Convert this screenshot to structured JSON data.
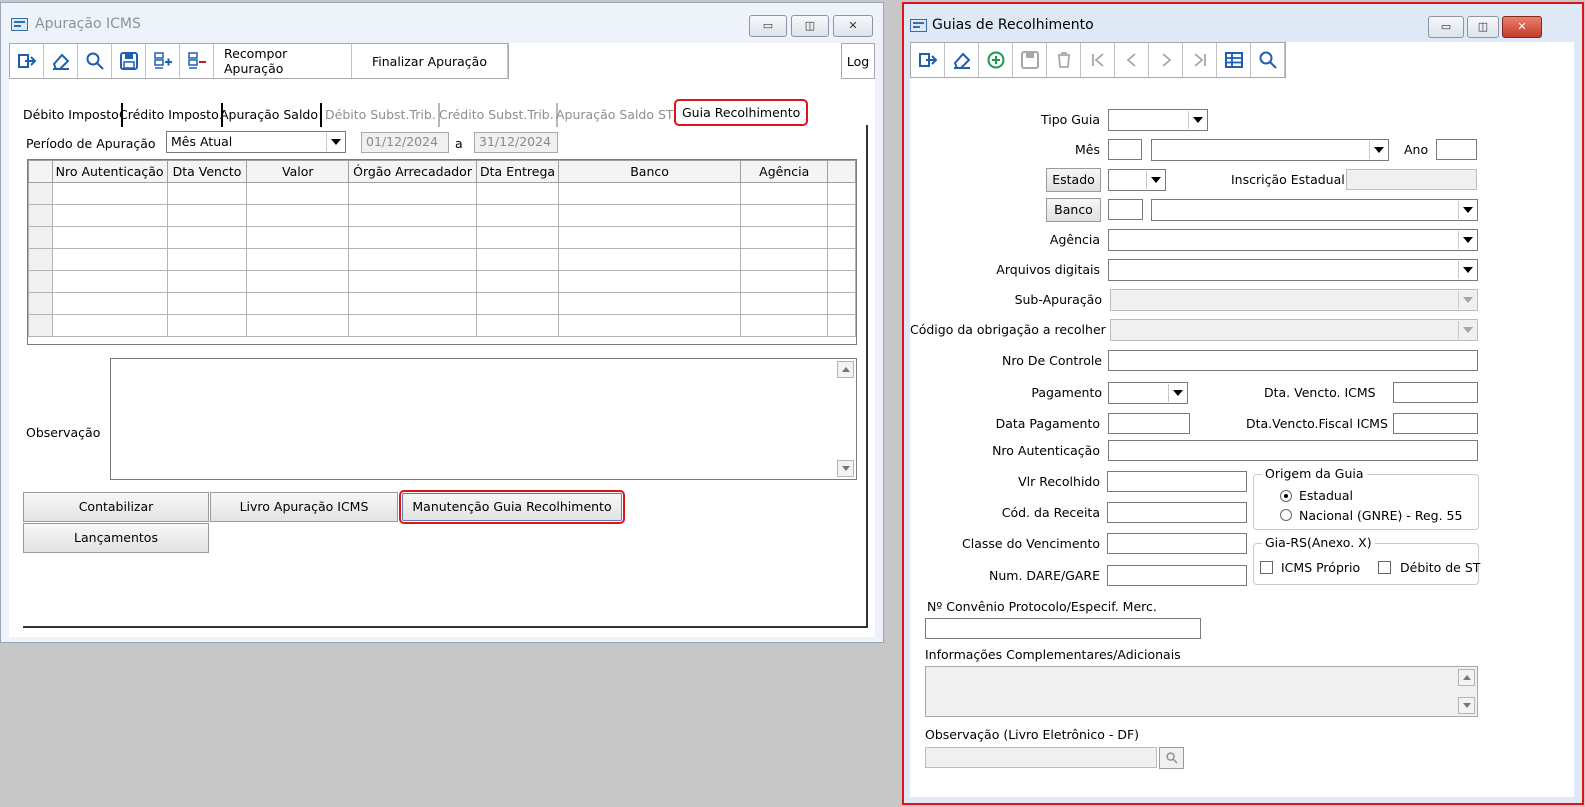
{
  "left_window": {
    "title": "Apuração ICMS",
    "caption_buttons": [
      "▭",
      "◫",
      "✕"
    ],
    "toolbar": {
      "recompor_label": "Recompor Apuração",
      "finalizar_label": "Finalizar Apuração",
      "log_label": "Log"
    },
    "tabs": [
      {
        "label": "Débito Imposto"
      },
      {
        "label": "Crédito Imposto"
      },
      {
        "label": "Apuração Saldo"
      },
      {
        "label": "Débito Subst.Trib."
      },
      {
        "label": "Crédito Subst.Trib."
      },
      {
        "label": "Apuração Saldo ST"
      },
      {
        "label": "Guia Recolhimento"
      }
    ],
    "periodo": {
      "label": "Período de Apuração",
      "selected": "Mês Atual",
      "start": "01/12/2024",
      "sep": "a",
      "end": "31/12/2024"
    },
    "grid_columns": [
      "Nro Autenticação",
      "Dta Vencto",
      "Valor",
      "Órgão Arrecadador",
      "Dta Entrega",
      "Banco",
      "Agência"
    ],
    "observacao_label": "Observação",
    "buttons": {
      "contabilizar": "Contabilizar",
      "livro": "Livro Apuração ICMS",
      "manutencao": "Manutenção Guia Recolhimento",
      "lancamentos": "Lançamentos"
    }
  },
  "right_window": {
    "title": "Guias de Recolhimento",
    "caption_buttons": [
      "▭",
      "◫",
      "✕"
    ],
    "fields": {
      "tipo_guia": "Tipo Guia",
      "mes": "Mês",
      "ano": "Ano",
      "estado_btn": "Estado",
      "inscricao": "Inscrição Estadual",
      "banco_btn": "Banco",
      "agencia": "Agência",
      "arquivos": "Arquivos digitais",
      "sub_apuracao": "Sub-Apuração",
      "codigo_obrigacao": "Código da obrigação a recolher",
      "nro_controle": "Nro De Controle",
      "pagamento": "Pagamento",
      "dta_vencto_icms": "Dta. Vencto. ICMS",
      "data_pagamento": "Data Pagamento",
      "dta_vencto_fiscal": "Dta.Vencto.Fiscal ICMS",
      "nro_autenticacao": "Nro Autenticação",
      "vlr_recolhido": "Vlr Recolhido",
      "cod_receita": "Cód. da Receita",
      "classe_vencimento": "Classe do Vencimento",
      "num_dare": "Num. DARE/GARE",
      "convenio": "Nº Convênio Protocolo/Especif. Merc.",
      "info_complementares": "Informações Complementares/Adicionais",
      "obs_livro": "Observação (Livro Eletrônico - DF)"
    },
    "origem_guia": {
      "title": "Origem da Guia",
      "opt1": "Estadual",
      "opt2": "Nacional (GNRE) - Reg. 55",
      "selected": "Estadual"
    },
    "gia_rs": {
      "title": "Gia-RS(Anexo. X)",
      "chk1": "ICMS Próprio",
      "chk2": "Débito de ST"
    }
  }
}
